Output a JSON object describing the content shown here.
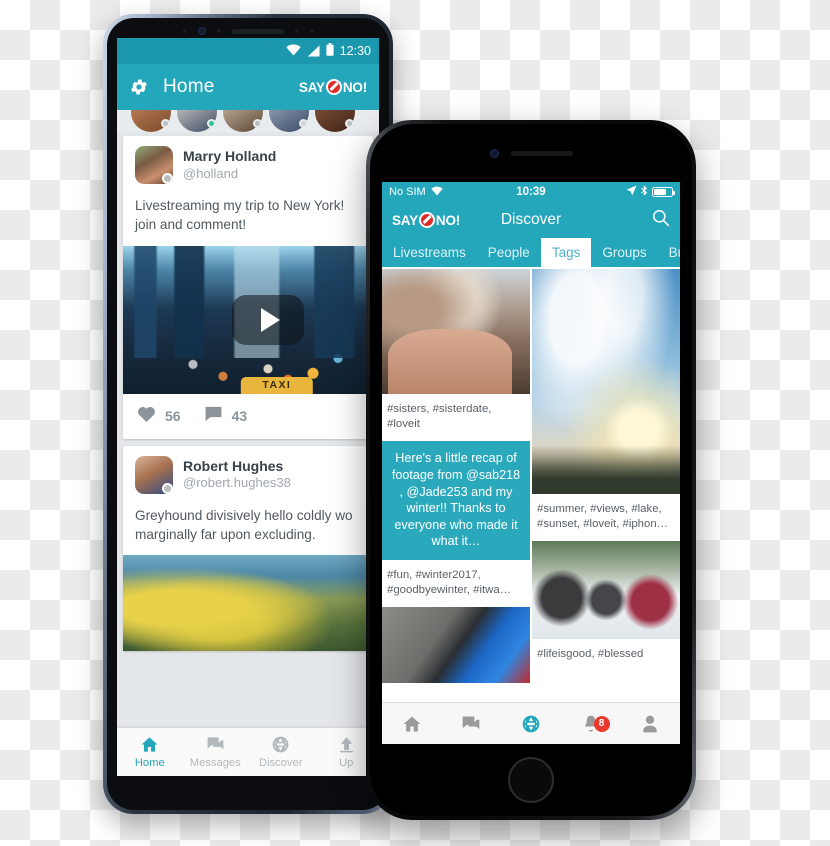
{
  "android": {
    "status_bar": {
      "time": "12:30",
      "wifi_icon": "wifi-icon",
      "signal_icon": "signal-icon",
      "battery_icon": "battery-icon"
    },
    "app_bar": {
      "settings_icon": "gear-icon",
      "title": "Home",
      "logo_say": "SAY",
      "logo_no": "NO!",
      "logo_icon": "prohibition-sign-icon"
    },
    "posts": [
      {
        "name": "Marry Holland",
        "handle": "@holland",
        "text": "Livestreaming my trip to New York! join and comment!",
        "likes": "56",
        "comments": "43",
        "media_caption": "TAXI",
        "play_icon": "play-icon",
        "like_icon": "heart-icon",
        "comment_icon": "comment-icon"
      },
      {
        "name": "Robert Hughes",
        "handle": "@robert.hughes38",
        "text": "Greyhound divisively hello coldly wo marginally far upon excluding."
      }
    ],
    "nav": [
      {
        "label": "Home",
        "icon": "home-icon",
        "active": true
      },
      {
        "label": "Messages",
        "icon": "messages-icon",
        "active": false
      },
      {
        "label": "Discover",
        "icon": "globe-icon",
        "active": false
      },
      {
        "label": "Up",
        "icon": "upload-icon",
        "active": false
      }
    ]
  },
  "iphone": {
    "status_bar": {
      "carrier": "No SIM",
      "wifi_icon": "wifi-icon",
      "time": "10:39",
      "location_icon": "location-arrow-icon",
      "bluetooth_icon": "bluetooth-icon",
      "battery_icon": "battery-icon"
    },
    "nav_bar": {
      "logo_say": "SAY",
      "logo_no": "NO!",
      "logo_icon": "prohibition-sign-icon",
      "title": "Discover",
      "search_icon": "search-icon"
    },
    "tabs": [
      {
        "label": "Livestreams",
        "active": false
      },
      {
        "label": "People",
        "active": false
      },
      {
        "label": "Tags",
        "active": true
      },
      {
        "label": "Groups",
        "active": false
      },
      {
        "label": "Bu",
        "active": false
      }
    ],
    "left_column": {
      "caption_1": "#sisters, #sisterdate, #loveit",
      "quote": "Here's a little recap of footage from @sab218 , @Jade253 and my winter!! Thanks to everyone who made it what it…",
      "caption_2": "#fun, #winter2017, #goodbyewinter, #itwa…"
    },
    "right_column": {
      "caption_1": "#summer, #views, #lake, #sunset, #loveit, #iphon…",
      "caption_2": "#lifeisgood, #blessed"
    },
    "tab_bar": [
      {
        "icon": "home-icon",
        "active": false,
        "badge": ""
      },
      {
        "icon": "messages-icon",
        "active": false,
        "badge": ""
      },
      {
        "icon": "globe-icon",
        "active": true,
        "badge": ""
      },
      {
        "icon": "bell-icon",
        "active": false,
        "badge": "8"
      },
      {
        "icon": "profile-icon",
        "active": false,
        "badge": ""
      }
    ]
  },
  "colors": {
    "teal": "#24a6bb",
    "teal_quote": "#2aa9bd",
    "badge_red": "#e8392c",
    "logo_red": "#e02b28"
  }
}
